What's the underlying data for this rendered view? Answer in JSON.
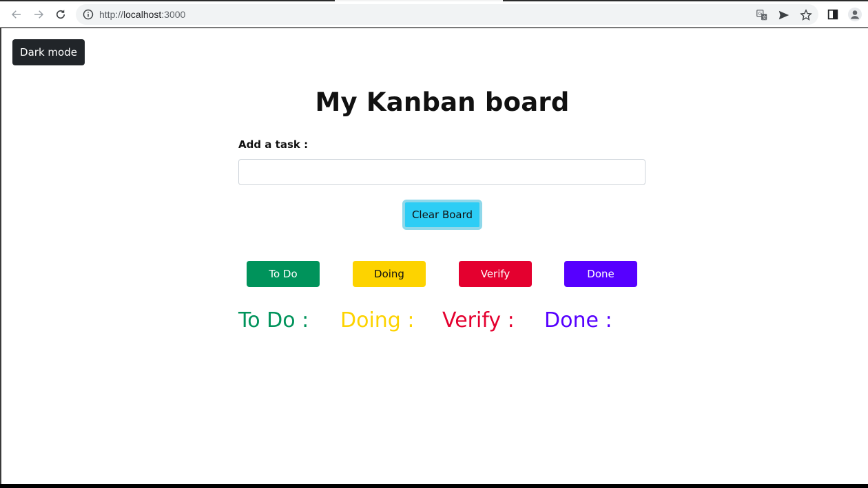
{
  "browser": {
    "url_scheme": "http://",
    "url_host": "localhost",
    "url_port": ":3000"
  },
  "page": {
    "dark_mode_label": "Dark mode",
    "title": "My Kanban board",
    "add_task_label": "Add a task :",
    "task_input_value": "",
    "clear_board_label": "Clear Board"
  },
  "status_buttons": [
    {
      "label": "To Do",
      "color": "#00935b",
      "text_color": "#ffffff"
    },
    {
      "label": "Doing",
      "color": "#fdd300",
      "text_color": "#111111"
    },
    {
      "label": "Verify",
      "color": "#e4002f",
      "text_color": "#ffffff"
    },
    {
      "label": "Done",
      "color": "#5600ff",
      "text_color": "#ffffff"
    }
  ],
  "columns": [
    {
      "heading": "To Do :",
      "color": "#00935b"
    },
    {
      "heading": "Doing :",
      "color": "#fdd300"
    },
    {
      "heading": "Verify :",
      "color": "#e4002f"
    },
    {
      "heading": "Done :",
      "color": "#5600ff"
    }
  ],
  "icons": {
    "back": "arrow-left-icon",
    "forward": "arrow-right-icon",
    "reload": "reload-icon",
    "site_info": "info-icon",
    "translate": "translate-icon",
    "send": "send-icon",
    "bookmark": "star-icon",
    "side_panel": "side-panel-icon",
    "profile": "profile-icon"
  }
}
